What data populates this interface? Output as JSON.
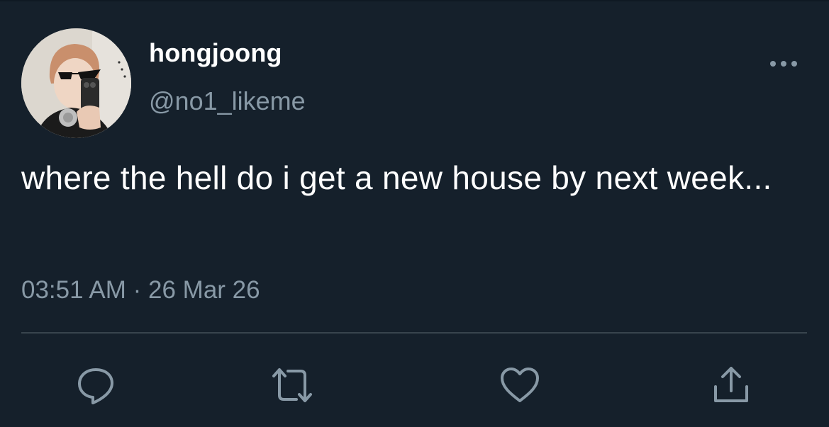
{
  "user": {
    "display_name": "hongjoong",
    "handle": "@no1_likeme"
  },
  "tweet": {
    "text": "where the hell do i get a new house by next week...",
    "time": "03:51 AM",
    "separator": "·",
    "date": "26 Mar 26"
  },
  "actions": {
    "more": "more-options-icon",
    "reply": "reply-icon",
    "retweet": "retweet-icon",
    "like": "heart-icon",
    "share": "share-icon"
  },
  "colors": {
    "background": "#15202b",
    "primary_text": "#ffffff",
    "secondary_text": "#8899a6",
    "divider": "#38444d"
  }
}
